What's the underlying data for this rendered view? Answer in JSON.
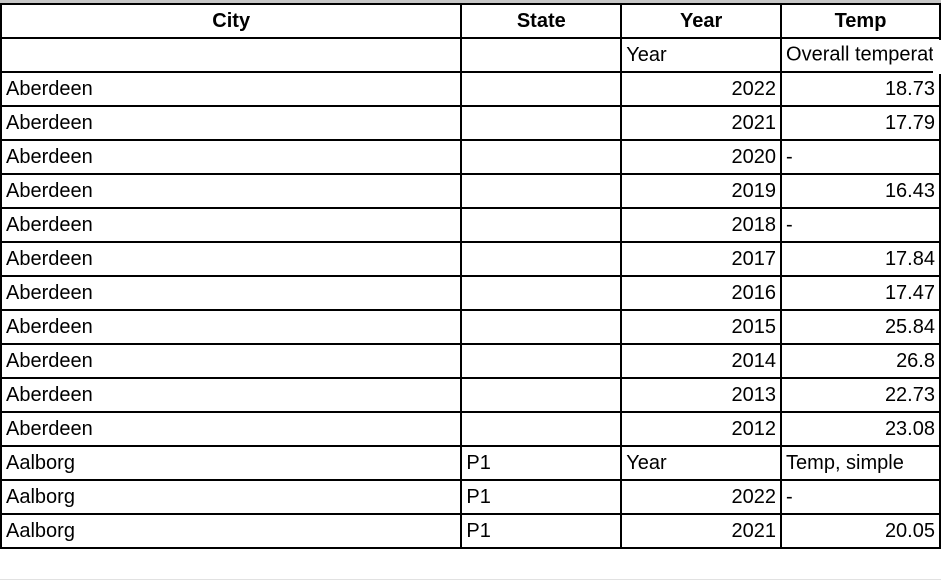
{
  "sheet": {
    "headers": [
      "City",
      "State",
      "Year",
      "Temp"
    ],
    "subheader": {
      "city": "",
      "state": "",
      "year": "Year",
      "temp": "Overall temperatu"
    },
    "rows": [
      {
        "city": "Aberdeen",
        "state": "",
        "year": "2022",
        "temp": "18.73",
        "year_align": "right",
        "temp_align": "right"
      },
      {
        "city": "Aberdeen",
        "state": "",
        "year": "2021",
        "temp": "17.79",
        "year_align": "right",
        "temp_align": "right"
      },
      {
        "city": "Aberdeen",
        "state": "",
        "year": "2020",
        "temp": "-",
        "year_align": "right",
        "temp_align": "left"
      },
      {
        "city": "Aberdeen",
        "state": "",
        "year": "2019",
        "temp": "16.43",
        "year_align": "right",
        "temp_align": "right"
      },
      {
        "city": "Aberdeen",
        "state": "",
        "year": "2018",
        "temp": "-",
        "year_align": "right",
        "temp_align": "left"
      },
      {
        "city": "Aberdeen",
        "state": "",
        "year": "2017",
        "temp": "17.84",
        "year_align": "right",
        "temp_align": "right"
      },
      {
        "city": "Aberdeen",
        "state": "",
        "year": "2016",
        "temp": "17.47",
        "year_align": "right",
        "temp_align": "right"
      },
      {
        "city": "Aberdeen",
        "state": "",
        "year": "2015",
        "temp": "25.84",
        "year_align": "right",
        "temp_align": "right"
      },
      {
        "city": "Aberdeen",
        "state": "",
        "year": "2014",
        "temp": "26.8",
        "year_align": "right",
        "temp_align": "right"
      },
      {
        "city": "Aberdeen",
        "state": "",
        "year": "2013",
        "temp": "22.73",
        "year_align": "right",
        "temp_align": "right"
      },
      {
        "city": "Aberdeen",
        "state": "",
        "year": "2012",
        "temp": "23.08",
        "year_align": "right",
        "temp_align": "right"
      },
      {
        "city": "Aalborg",
        "state": "P1",
        "year": "Year",
        "temp": "Temp, simple",
        "year_align": "left",
        "temp_align": "left"
      },
      {
        "city": "Aalborg",
        "state": "P1",
        "year": "2022",
        "temp": "-",
        "year_align": "right",
        "temp_align": "left"
      },
      {
        "city": "Aalborg",
        "state": "P1",
        "year": "2021",
        "temp": "20.05",
        "year_align": "right",
        "temp_align": "right"
      }
    ]
  }
}
